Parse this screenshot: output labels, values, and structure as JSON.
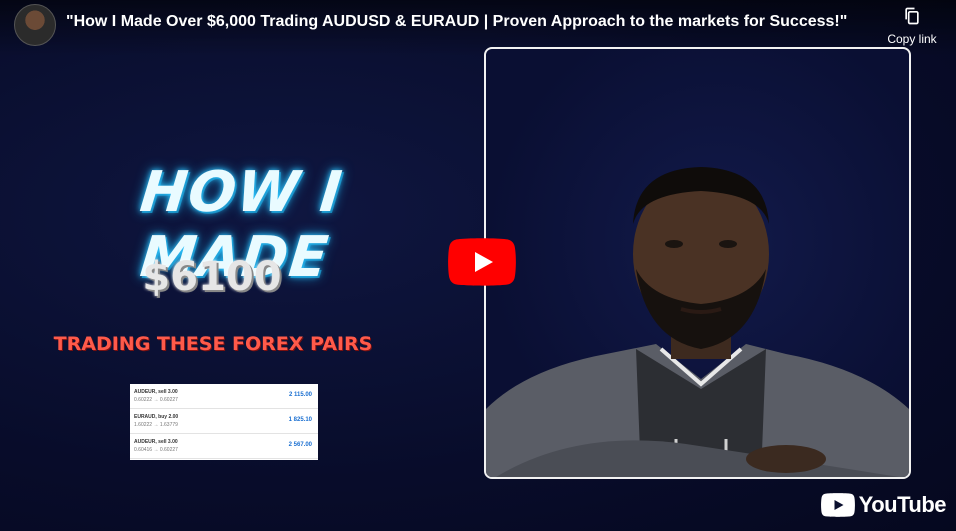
{
  "video": {
    "title": "\"How I Made Over $6,000 Trading AUDUSD & EURAUD | Proven Approach to the markets for Success!\"",
    "copy_link_label": "Copy link"
  },
  "thumbnail": {
    "headline": "HOW I MADE",
    "amount": "$6100",
    "subheadline": "TRADING THESE FOREX PAIRS",
    "trades": [
      {
        "pair": "AUDEUR, sell 3.00",
        "detail": "0.60222 → 0.60227",
        "profit": "2 115.00"
      },
      {
        "pair": "EURAUD, buy 2.00",
        "detail": "1.60222 → 1.63779",
        "profit": "1 825.10"
      },
      {
        "pair": "AUDEUR, sell 3.00",
        "detail": "0.60416 → 0.60227",
        "profit": "2 567.00"
      }
    ]
  },
  "branding": {
    "platform": "YouTube"
  },
  "colors": {
    "play_red": "#ff0000",
    "headline_glow": "#2fc6ff",
    "subheadline": "#ff5a4a"
  },
  "icons": {
    "copy": "copy-icon",
    "play": "play-icon",
    "logo": "youtube-logo-icon"
  }
}
